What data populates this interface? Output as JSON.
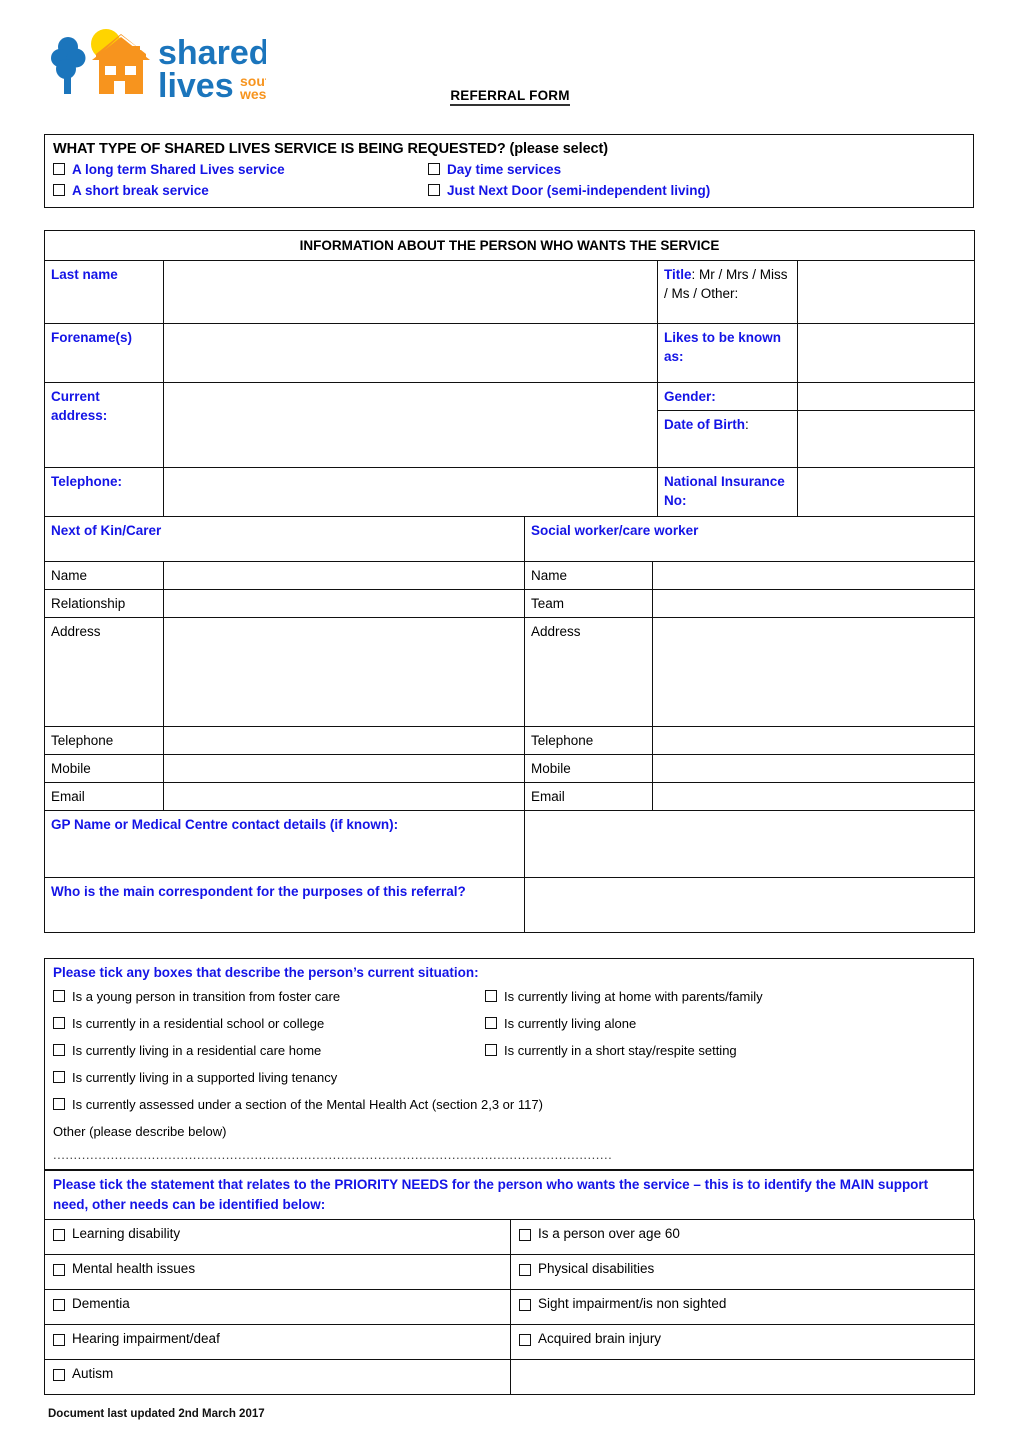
{
  "header": {
    "form_title": "REFERRAL FORM ",
    "logo": {
      "name": "shared-lives-south-west-logo",
      "word1": "shared",
      "word2": "lives",
      "sub1": "south",
      "sub2": "west",
      "blue": "#1b75bc",
      "orange": "#f7941e",
      "yellow": "#ffd400"
    }
  },
  "service_type": {
    "question": "WHAT TYPE OF SHARED LIVES SERVICE IS BEING REQUESTED? (please  select)",
    "options": [
      {
        "label": "A long term Shared Lives service"
      },
      {
        "label": "Day time services"
      },
      {
        "label": "A short break service"
      },
      {
        "label": "Just Next Door (semi-independent living)"
      }
    ]
  },
  "info": {
    "heading": "INFORMATION ABOUT THE PERSON WHO WANTS THE SERVICE",
    "last_name": "Last name",
    "title_label": "Title",
    "title_options": ": Mr / Mrs / Miss / Ms / Other:",
    "forenames": "Forename(s)",
    "likes_known_as": "Likes to be known as:",
    "current_address": "Current address:",
    "gender": "Gender:",
    "date_of_birth_label": "Date of Birth",
    "date_of_birth_colon": ":",
    "telephone": "Telephone:",
    "national_insurance": "National Insurance No:"
  },
  "contacts": {
    "next_of_kin_heading": "Next of Kin/Carer",
    "social_worker_heading": "Social worker/care worker",
    "kin_rows": [
      "Name",
      "Relationship",
      "Address",
      "Telephone",
      "Mobile",
      "Email"
    ],
    "worker_rows": [
      "Name",
      "Team",
      "Address",
      "Telephone",
      "Mobile",
      "Email"
    ],
    "gp_label": "GP Name or Medical Centre contact details (if known):",
    "correspondent_label": "Who is the main correspondent for the purposes of this referral?"
  },
  "situation": {
    "title": "Please tick any boxes that describe the person’s current situation:",
    "col1": [
      "Is a young person in transition from foster care",
      "Is currently in a residential school or college",
      "Is currently living in a residential care home",
      "Is currently living in a supported living tenancy",
      "Is currently assessed under a section of the Mental Health Act (section 2,3 or 117)"
    ],
    "col2": [
      "Is currently living at home with parents/family",
      "Is currently living alone",
      "Is currently in a short stay/respite setting"
    ],
    "other_label": "Other (please describe below)",
    "dotted_line": "........................................................................................................................................"
  },
  "priority": {
    "title": "Please tick the statement that relates to the PRIORITY NEEDS for the person who wants the service – this is to identify the MAIN support need, other needs can be identified below:",
    "rows": [
      {
        "left": "Learning disability",
        "right": "Is a person over age 60"
      },
      {
        "left": "Mental health issues",
        "right": "Physical disabilities"
      },
      {
        "left": "Dementia",
        "right": "Sight impairment/is non sighted"
      },
      {
        "left": "Hearing impairment/deaf",
        "right": "Acquired brain injury"
      },
      {
        "left": "Autism",
        "right": ""
      }
    ]
  },
  "footer": {
    "text": "Document last updated 2nd March 2017"
  }
}
